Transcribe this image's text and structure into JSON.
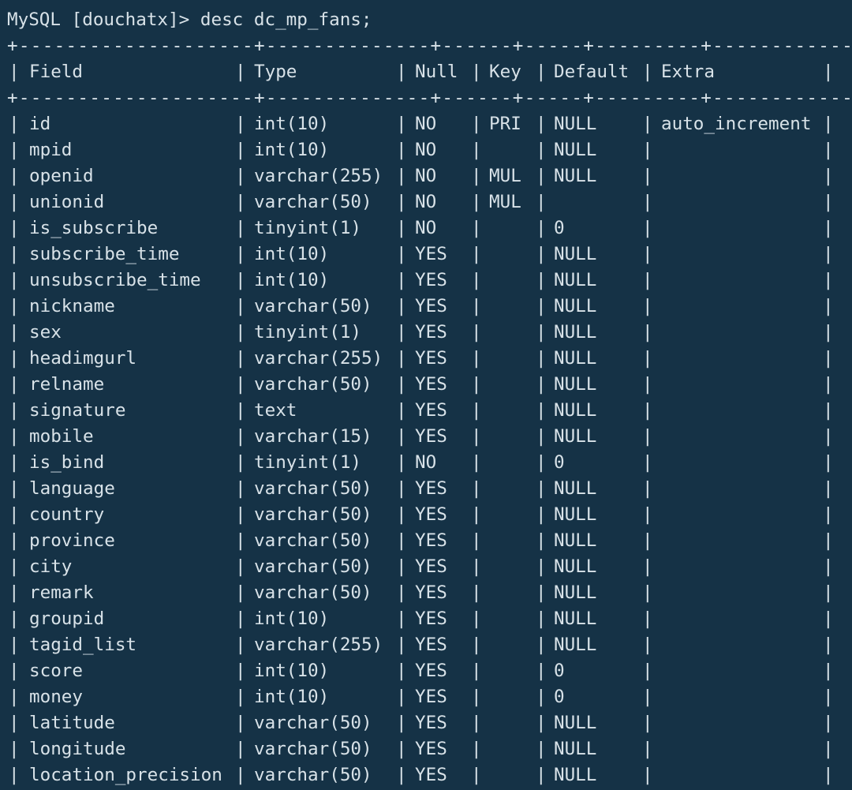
{
  "terminal": {
    "prompt": "MySQL [douchatx]>",
    "command": "desc dc_mp_fans;",
    "separator": "+--------------------+--------------+------+-----+---------+----------------+",
    "columns": [
      "Field",
      "Type",
      "Null",
      "Key",
      "Default",
      "Extra"
    ],
    "rows": [
      {
        "field": "id",
        "type": "int(10)",
        "null": "NO",
        "key": "PRI",
        "default": "NULL",
        "extra": "auto_increment"
      },
      {
        "field": "mpid",
        "type": "int(10)",
        "null": "NO",
        "key": "",
        "default": "NULL",
        "extra": ""
      },
      {
        "field": "openid",
        "type": "varchar(255)",
        "null": "NO",
        "key": "MUL",
        "default": "NULL",
        "extra": ""
      },
      {
        "field": "unionid",
        "type": "varchar(50)",
        "null": "NO",
        "key": "MUL",
        "default": "",
        "extra": ""
      },
      {
        "field": "is_subscribe",
        "type": "tinyint(1)",
        "null": "NO",
        "key": "",
        "default": "0",
        "extra": ""
      },
      {
        "field": "subscribe_time",
        "type": "int(10)",
        "null": "YES",
        "key": "",
        "default": "NULL",
        "extra": ""
      },
      {
        "field": "unsubscribe_time",
        "type": "int(10)",
        "null": "YES",
        "key": "",
        "default": "NULL",
        "extra": ""
      },
      {
        "field": "nickname",
        "type": "varchar(50)",
        "null": "YES",
        "key": "",
        "default": "NULL",
        "extra": ""
      },
      {
        "field": "sex",
        "type": "tinyint(1)",
        "null": "YES",
        "key": "",
        "default": "NULL",
        "extra": ""
      },
      {
        "field": "headimgurl",
        "type": "varchar(255)",
        "null": "YES",
        "key": "",
        "default": "NULL",
        "extra": ""
      },
      {
        "field": "relname",
        "type": "varchar(50)",
        "null": "YES",
        "key": "",
        "default": "NULL",
        "extra": ""
      },
      {
        "field": "signature",
        "type": "text",
        "null": "YES",
        "key": "",
        "default": "NULL",
        "extra": ""
      },
      {
        "field": "mobile",
        "type": "varchar(15)",
        "null": "YES",
        "key": "",
        "default": "NULL",
        "extra": ""
      },
      {
        "field": "is_bind",
        "type": "tinyint(1)",
        "null": "NO",
        "key": "",
        "default": "0",
        "extra": ""
      },
      {
        "field": "language",
        "type": "varchar(50)",
        "null": "YES",
        "key": "",
        "default": "NULL",
        "extra": ""
      },
      {
        "field": "country",
        "type": "varchar(50)",
        "null": "YES",
        "key": "",
        "default": "NULL",
        "extra": ""
      },
      {
        "field": "province",
        "type": "varchar(50)",
        "null": "YES",
        "key": "",
        "default": "NULL",
        "extra": ""
      },
      {
        "field": "city",
        "type": "varchar(50)",
        "null": "YES",
        "key": "",
        "default": "NULL",
        "extra": ""
      },
      {
        "field": "remark",
        "type": "varchar(50)",
        "null": "YES",
        "key": "",
        "default": "NULL",
        "extra": ""
      },
      {
        "field": "groupid",
        "type": "int(10)",
        "null": "YES",
        "key": "",
        "default": "NULL",
        "extra": ""
      },
      {
        "field": "tagid_list",
        "type": "varchar(255)",
        "null": "YES",
        "key": "",
        "default": "NULL",
        "extra": ""
      },
      {
        "field": "score",
        "type": "int(10)",
        "null": "YES",
        "key": "",
        "default": "0",
        "extra": ""
      },
      {
        "field": "money",
        "type": "int(10)",
        "null": "YES",
        "key": "",
        "default": "0",
        "extra": ""
      },
      {
        "field": "latitude",
        "type": "varchar(50)",
        "null": "YES",
        "key": "",
        "default": "NULL",
        "extra": ""
      },
      {
        "field": "longitude",
        "type": "varchar(50)",
        "null": "YES",
        "key": "",
        "default": "NULL",
        "extra": ""
      },
      {
        "field": "location_precision",
        "type": "varchar(50)",
        "null": "YES",
        "key": "",
        "default": "NULL",
        "extra": ""
      }
    ],
    "colors": {
      "background": "#153246",
      "text": "#d8e2e8"
    }
  }
}
